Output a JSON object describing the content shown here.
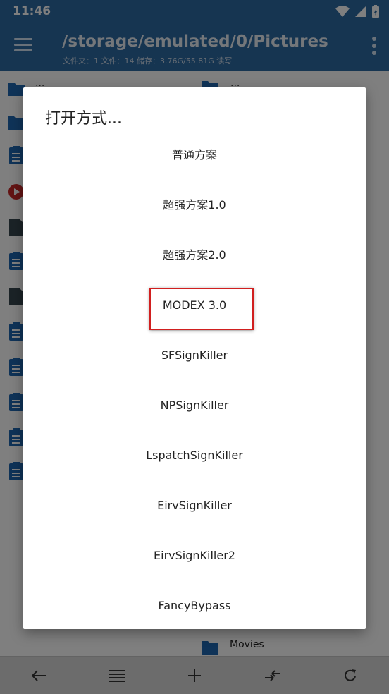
{
  "status_bar": {
    "time": "11:46"
  },
  "app_bar": {
    "path": "/storage/emulated/0/Pictures",
    "info": "文件夹：1 文件：14   储存：3.76G/55.81G     读写"
  },
  "left_pane": {
    "parent_dots": "..."
  },
  "right_pane": {
    "parent_dots": "...",
    "bottom_item": "Movies"
  },
  "dialog": {
    "title": "打开方式...",
    "options": [
      "普通方案",
      "超强方案1.0",
      "超强方案2.0",
      "MODEX 3.0",
      "SFSignKiller",
      "NPSignKiller",
      "LspatchSignKiller",
      "EirvSignKiller",
      "EirvSignKiller2",
      "FancyBypass"
    ],
    "highlighted_option": "MODEX 3.0"
  },
  "colors": {
    "app_bar": "#2d6aa3",
    "folder": "#1f66b1",
    "highlight": "#d11f1f"
  }
}
